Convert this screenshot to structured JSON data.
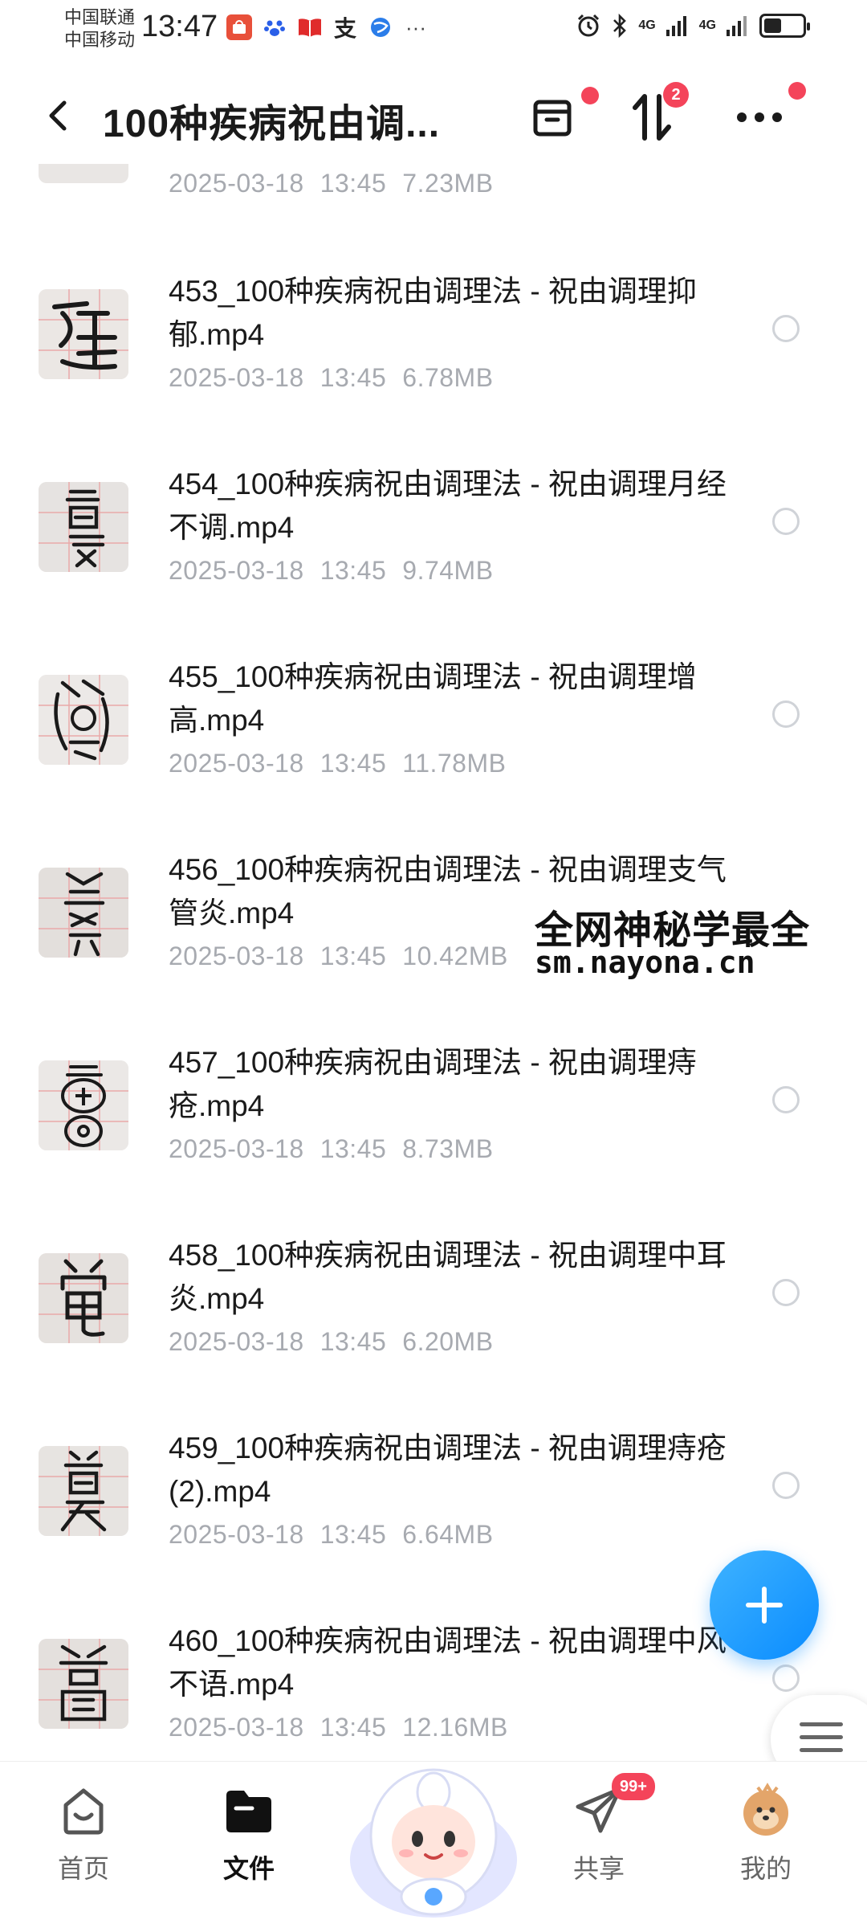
{
  "status_bar": {
    "carrier1": "中国联通",
    "carrier2": "中国移动",
    "time": "13:47",
    "signal1": "4G",
    "signal2": "4G",
    "battery_level": 0.45,
    "app_icons": [
      "huawei-store-icon",
      "baidu-paw-icon",
      "red-book-icon",
      "alipay-icon",
      "globe-icon",
      "more-dots-icon"
    ],
    "system_icons": [
      "alarm-icon",
      "bluetooth-icon",
      "signal-icon",
      "signal-icon",
      "battery-icon"
    ]
  },
  "header": {
    "title": "100种疾病祝由调...",
    "transfer_badge": "2"
  },
  "top_partial": {
    "date": "2025-03-18",
    "time": "13:45",
    "size": "7.23MB"
  },
  "files": [
    {
      "name": "453_100种疾病祝由调理法 - 祝由调理抑郁.mp4",
      "date": "2025-03-18",
      "time": "13:45",
      "size": "6.78MB"
    },
    {
      "name": "454_100种疾病祝由调理法 - 祝由调理月经不调.mp4",
      "date": "2025-03-18",
      "time": "13:45",
      "size": "9.74MB"
    },
    {
      "name": "455_100种疾病祝由调理法 - 祝由调理增高.mp4",
      "date": "2025-03-18",
      "time": "13:45",
      "size": "11.78MB"
    },
    {
      "name": "456_100种疾病祝由调理法 - 祝由调理支气管炎.mp4",
      "date": "2025-03-18",
      "time": "13:45",
      "size": "10.42MB"
    },
    {
      "name": "457_100种疾病祝由调理法 - 祝由调理痔疮.mp4",
      "date": "2025-03-18",
      "time": "13:45",
      "size": "8.73MB"
    },
    {
      "name": "458_100种疾病祝由调理法 - 祝由调理中耳炎.mp4",
      "date": "2025-03-18",
      "time": "13:45",
      "size": "6.20MB"
    },
    {
      "name": "459_100种疾病祝由调理法 - 祝由调理痔疮 (2).mp4",
      "date": "2025-03-18",
      "time": "13:45",
      "size": "6.64MB"
    },
    {
      "name": "460_100种疾病祝由调理法 - 祝由调理中风不语.mp4",
      "date": "2025-03-18",
      "time": "13:45",
      "size": "12.16MB"
    }
  ],
  "watermark": {
    "line1": "全网神秘学最全",
    "line2": "sm.nayona.cn"
  },
  "bottom_nav": {
    "home": "首页",
    "files": "文件",
    "share": "共享",
    "share_badge": "99+",
    "me": "我的"
  },
  "colors": {
    "accent_blue": "#0a8cff",
    "badge_red": "#f4445a",
    "meta_gray": "#a7aab0"
  }
}
